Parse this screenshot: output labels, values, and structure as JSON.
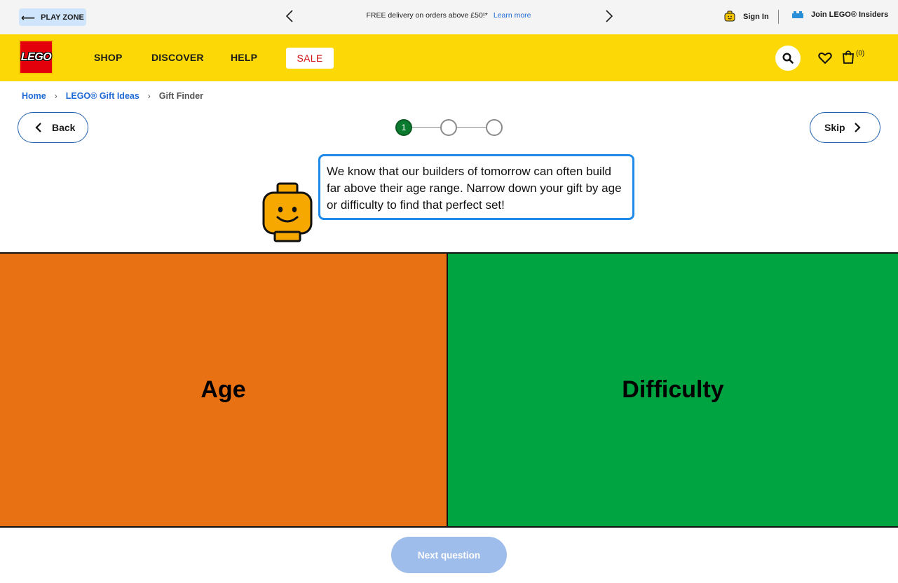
{
  "topbar": {
    "play_zone_label": "PLAY ZONE",
    "promo_text": "FREE delivery on orders above £50!*",
    "promo_link": "Learn more",
    "sign_in_label": "Sign In",
    "insiders_label": "Join LEGO® Insiders"
  },
  "nav": {
    "logo_text": "LEGO",
    "items": [
      {
        "label": "SHOP"
      },
      {
        "label": "DISCOVER"
      },
      {
        "label": "HELP"
      }
    ],
    "sale_label": "SALE",
    "bag_count": "(0)"
  },
  "breadcrumb": {
    "items": [
      {
        "label": "Home"
      },
      {
        "label": "LEGO® Gift Ideas"
      },
      {
        "label": "Gift Finder"
      }
    ]
  },
  "controls": {
    "back_label": "Back",
    "skip_label": "Skip"
  },
  "stepper": {
    "current_step": "1",
    "total_steps": 3
  },
  "speech": {
    "text": "We know that our builders of tomorrow can often build far above their age range. Narrow down your gift by age or difficulty to find that perfect set!"
  },
  "choices": {
    "age": {
      "label": "Age",
      "color": "#e87114"
    },
    "difficulty": {
      "label": "Difficulty",
      "color": "#00a541"
    }
  },
  "footer": {
    "next_label": "Next question"
  },
  "colors": {
    "brand_yellow": "#fbd806",
    "link_blue": "#1f6ad6",
    "speech_border": "#1f8ae8",
    "step_active": "#0a7a2f",
    "next_disabled": "#9fbdeb"
  }
}
